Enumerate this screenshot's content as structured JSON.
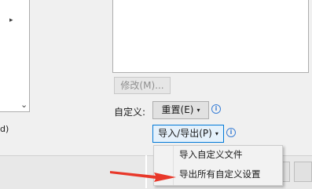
{
  "left_panel": {
    "expand_glyph": "▸",
    "scroll_down_glyph": "⌄",
    "clipped_label": "d)"
  },
  "modify_button": {
    "label": "修改(M)..."
  },
  "customize": {
    "label": "自定义:",
    "reset_button": {
      "label": "重置(E)",
      "caret": "▾"
    },
    "import_export_button": {
      "label": "导入/导出(P)",
      "caret": "▾"
    },
    "info_glyph": "i"
  },
  "menu": {
    "items": [
      {
        "label": "导入自定义文件"
      },
      {
        "label": "导出所有自定义设置"
      }
    ]
  },
  "colors": {
    "annotation_arrow": "#e8382a",
    "info_icon": "#3a7fd6"
  }
}
